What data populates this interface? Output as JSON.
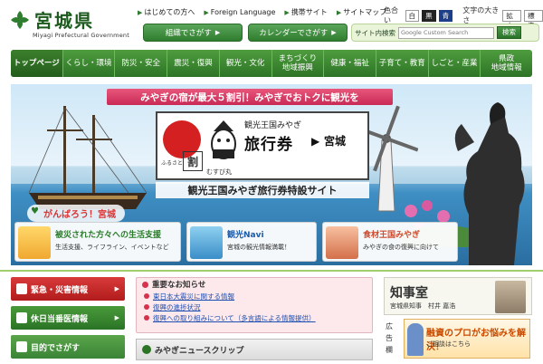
{
  "header": {
    "logo_title": "宮城県",
    "logo_sub": "Miyagi Prefectural Government",
    "util_links": [
      "はじめての方へ",
      "Foreign Language",
      "携帯サイト",
      "サイトマップ"
    ],
    "color_label": "色合い",
    "color_options": [
      "白",
      "黒",
      "青"
    ],
    "font_size_label": "文字の大きさ",
    "font_size_options": [
      "拡大",
      "標準"
    ],
    "org_button": "組織でさがす",
    "calendar_button": "カレンダーでさがす",
    "search_label": "サイト内検索",
    "search_placeholder": "Google Custom Search",
    "search_button": "検索"
  },
  "nav": {
    "items": [
      "トップページ",
      "くらし・環境",
      "防災・安全",
      "震災・復興",
      "観光・文化",
      "まちづくり\n地域振興",
      "健康・福祉",
      "子育て・教育",
      "しごと・産業",
      "県政\n地域情報"
    ],
    "active_index": 0
  },
  "banner": {
    "headline": "みやぎの宿が最大５割引！みやぎでおトクに観光を",
    "ticket_sub": "観光王国みやぎ",
    "ticket_main": "旅行券",
    "ticket_dest": "宮城",
    "furusato": "ふるさと",
    "wari": "割",
    "mascot_name": "むすび丸",
    "site_title": "観光王国みやぎ旅行券特設サイト",
    "ganbaro": "がんばろう！宮城",
    "promos": [
      {
        "title": "被災された方々への生活支援",
        "sub": "生活支援、ライフライン、イベントなど",
        "color": "#2a7a2a"
      },
      {
        "title": "観光Navi",
        "sub": "宮城の観光情報満載！",
        "color": "#1d5aa6"
      },
      {
        "title": "食材王国みやぎ",
        "sub": "みやぎの食の復興に向けて",
        "color": "#d14a2a"
      }
    ]
  },
  "left_menu": {
    "emergency": "緊急・災害情報",
    "holiday_doctor": "休日当番医情報",
    "purpose": "目的でさがす"
  },
  "notice": {
    "title": "重要なお知らせ",
    "items": [
      "東日本大震災に関する情報",
      "復興の進捗状況",
      "復興への取り組みについて（多言語による情報提供）"
    ]
  },
  "news": {
    "title": "みやぎニュースクリップ"
  },
  "governor": {
    "title": "知事室",
    "sub": "宮城県知事　村井 嘉浩"
  },
  "ad": {
    "label": "広告欄",
    "t1": "融資のプロがお悩みを解決！",
    "t2": "ご相談はこちら"
  },
  "colors": {
    "brand_green": "#2f7d2f",
    "accent_red": "#c92a55",
    "notice_bg": "#fde9ec"
  }
}
